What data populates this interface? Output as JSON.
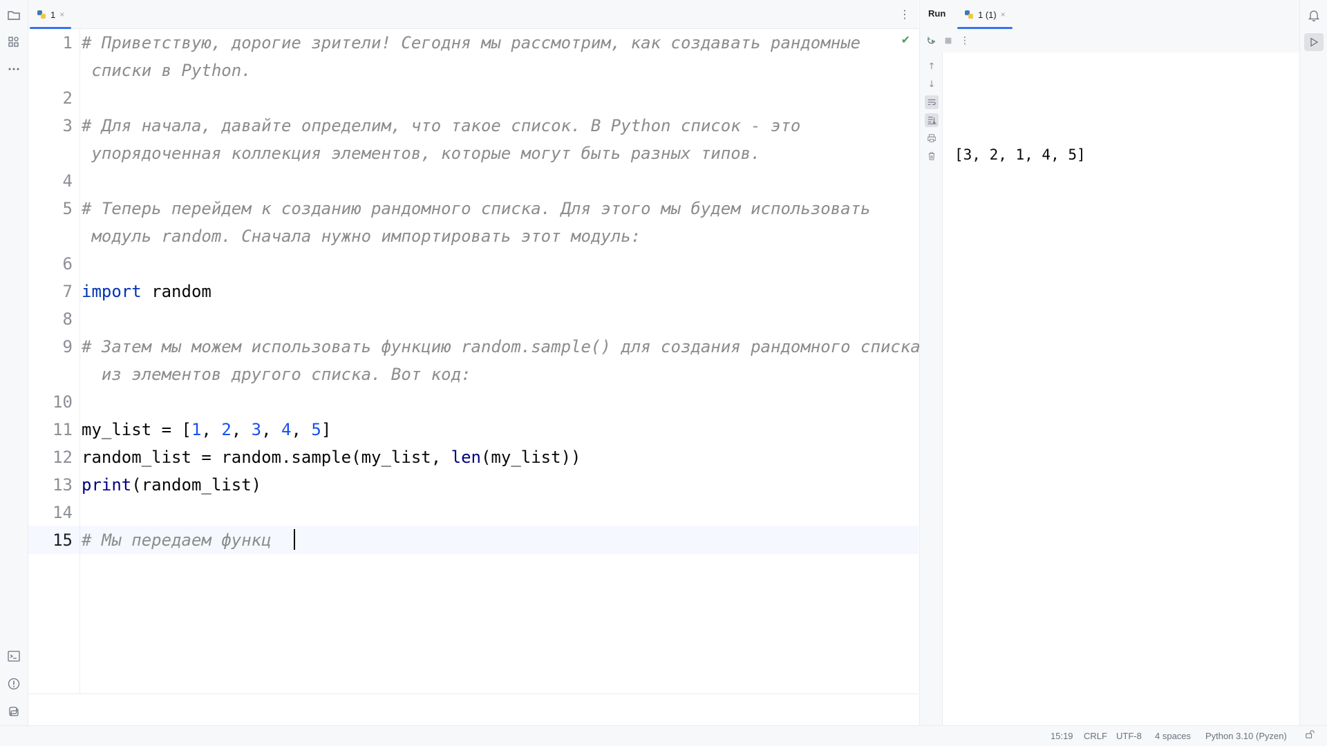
{
  "editor": {
    "tab_label": "1",
    "tab_close": "×",
    "more_menu": "⋮",
    "lines": [
      {
        "n": "1",
        "text": "# Приветствую, дорогие зрители! Сегодня мы рассмотрим, как создавать рандомные"
      },
      {
        "n": "",
        "text": " списки в Python."
      },
      {
        "n": "2",
        "text": ""
      },
      {
        "n": "3",
        "text": "# Для начала, давайте определим, что такое список. В Python список - это"
      },
      {
        "n": "",
        "text": " упорядоченная коллекция элементов, которые могут быть разных типов."
      },
      {
        "n": "4",
        "text": ""
      },
      {
        "n": "5",
        "text": "# Теперь перейдем к созданию рандомного списка. Для этого мы будем использовать"
      },
      {
        "n": "",
        "text": " модуль random. Сначала нужно импортировать этот модуль:"
      },
      {
        "n": "6",
        "text": ""
      },
      {
        "n": "7",
        "text": "import random"
      },
      {
        "n": "8",
        "text": ""
      },
      {
        "n": "9",
        "text": "# Затем мы можем использовать функцию random.sample() для создания рандомного списка"
      },
      {
        "n": "",
        "text": "  из элементов другого списка. Вот код:"
      },
      {
        "n": "10",
        "text": ""
      },
      {
        "n": "11",
        "text": "my_list = [1, 2, 3, 4, 5]"
      },
      {
        "n": "12",
        "text": "random_list = random.sample(my_list, len(my_list))"
      },
      {
        "n": "13",
        "text": "print(random_list)"
      },
      {
        "n": "14",
        "text": ""
      },
      {
        "n": "15",
        "text": "# Мы передаем функц"
      }
    ],
    "tokens": {
      "import_kw": "import",
      "import_mod": " random",
      "l11_a": "my_list = [",
      "l11_n1": "1",
      "l11_sep": ", ",
      "l11_n2": "2",
      "l11_n3": "3",
      "l11_n4": "4",
      "l11_n5": "5",
      "l11_end": "]",
      "l12_a": "random_list = random.sample(my_list, ",
      "l12_len": "len",
      "l12_b": "(my_list))",
      "l13_print": "print",
      "l13_b": "(random_list)"
    }
  },
  "run": {
    "title": "Run",
    "tab_label": "1 (1)",
    "tab_close": "×",
    "output": "[3, 2, 1, 4, 5]"
  },
  "status": {
    "position": "15:19",
    "line_separator": "CRLF",
    "encoding": "UTF-8",
    "indent": "4 spaces",
    "interpreter": "Python 3.10 (Pyzen)"
  },
  "colors": {
    "accent": "#3574f0",
    "keyword": "#0033b3",
    "number": "#1750eb",
    "comment": "#8c8c8c"
  },
  "icons": {
    "left_strip": [
      "folder-icon",
      "structure-icon",
      "more-icon",
      "terminal-icon",
      "problems-icon",
      "python-packages-icon"
    ],
    "run_toolbar": [
      "rerun-icon",
      "stop-icon",
      "more-vertical-icon"
    ],
    "run_sidebar": [
      "scroll-up-icon",
      "scroll-down-icon",
      "soft-wrap-icon",
      "scroll-to-end-icon",
      "print-icon",
      "clear-icon"
    ],
    "right_strip": [
      "notifications-icon",
      "run-icon"
    ]
  }
}
